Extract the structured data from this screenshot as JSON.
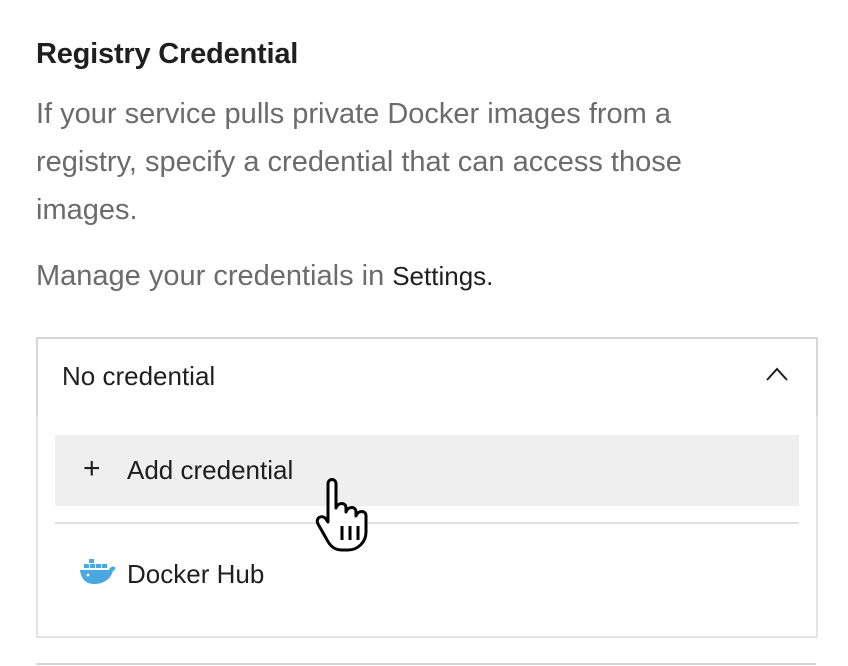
{
  "section": {
    "title": "Registry Credential",
    "description": "If your service pulls private Docker images from a registry, specify a credential that can access those images.",
    "manage_text": "Manage your credentials in",
    "manage_link": "Settings."
  },
  "credential_select": {
    "value": "No credential",
    "chevron_icon": "chevron-up-icon",
    "options": [
      {
        "icon": "plus-icon",
        "plus_glyph": "+",
        "label": "Add credential"
      },
      {
        "icon": "docker-icon",
        "label": "Docker Hub"
      }
    ]
  },
  "colors": {
    "text_primary": "#1f1f1f",
    "text_secondary": "#6b6b6b",
    "border": "#d6d6d6",
    "hover_bg": "#efefef",
    "docker_blue": "#4aa8e0"
  }
}
